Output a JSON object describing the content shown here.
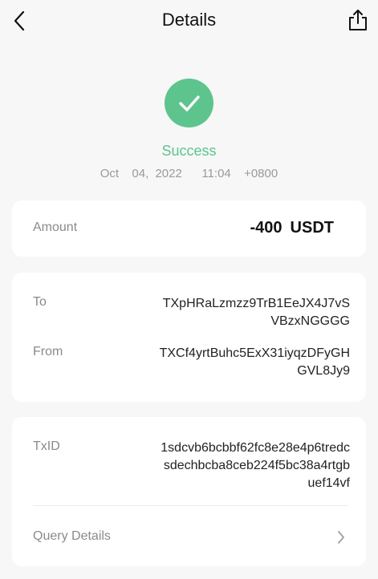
{
  "header": {
    "title": "Details"
  },
  "status": {
    "text": "Success",
    "timestamp": "Oct  04, 2022   11:04  +0800",
    "color": "#5ec48e"
  },
  "amount": {
    "label": "Amount",
    "value": "-400",
    "unit": "USDT"
  },
  "addresses": {
    "to_label": "To",
    "to_value": "TXpHRaLzmzz9TrB1EeJX4J7vS\nVBzxNGGGG",
    "from_label": "From",
    "from_value": "TXCf4yrtBuhc5ExX31iyqzDFyGH\nGVL8Jy9"
  },
  "transaction": {
    "txid_label": "TxID",
    "txid_value": "1sdcvb6bcbbf62fc8e28e4p6tredc\nsdechbcba8ceb224f5bc38a4rtgb\nuef14vf",
    "query_label": "Query Details"
  },
  "icons": {
    "back": "chevron-left-icon",
    "share": "share-icon",
    "status": "check-icon",
    "query": "chevron-right-icon"
  }
}
